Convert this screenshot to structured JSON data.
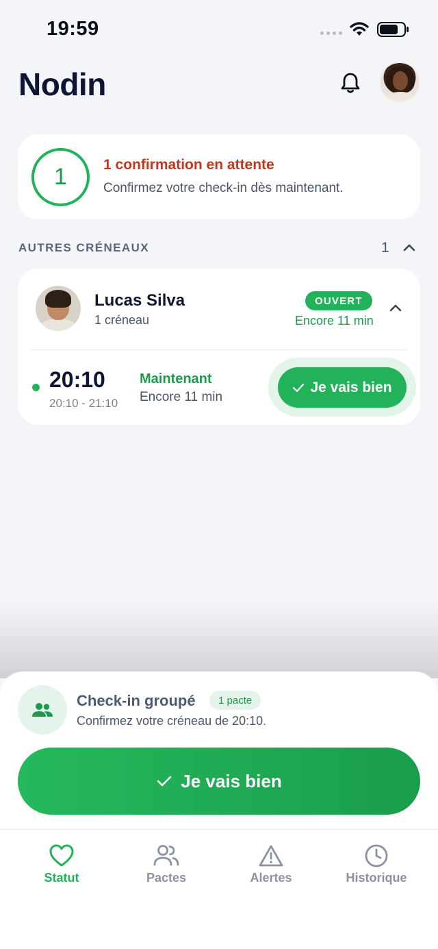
{
  "status_bar": {
    "time": "19:59"
  },
  "header": {
    "title": "Nodin"
  },
  "pending": {
    "count": "1",
    "title": "1 confirmation en attente",
    "subtitle": "Confirmez votre check-in dès maintenant."
  },
  "section": {
    "title": "AUTRES CRÉNEAUX",
    "count": "1"
  },
  "contact": {
    "name": "Lucas Silva",
    "slots": "1 créneau",
    "badge": "OUVERT",
    "remaining": "Encore 11 min",
    "slot": {
      "time": "20:10",
      "range": "20:10 - 21:10",
      "status": "Maintenant",
      "remaining": "Encore 11 min",
      "button": "Je vais bien"
    }
  },
  "sheet": {
    "title": "Check-in groupé",
    "badge": "1 pacte",
    "subtitle": "Confirmez votre créneau de 20:10.",
    "button": "Je vais bien"
  },
  "tabs": [
    {
      "label": "Statut",
      "icon": "heart-icon",
      "active": true
    },
    {
      "label": "Pactes",
      "icon": "users-icon",
      "active": false
    },
    {
      "label": "Alertes",
      "icon": "warning-icon",
      "active": false
    },
    {
      "label": "Historique",
      "icon": "clock-icon",
      "active": false
    }
  ],
  "colors": {
    "accent": "#22b35a",
    "alert": "#c2371e",
    "background": "#f4f5f9"
  }
}
